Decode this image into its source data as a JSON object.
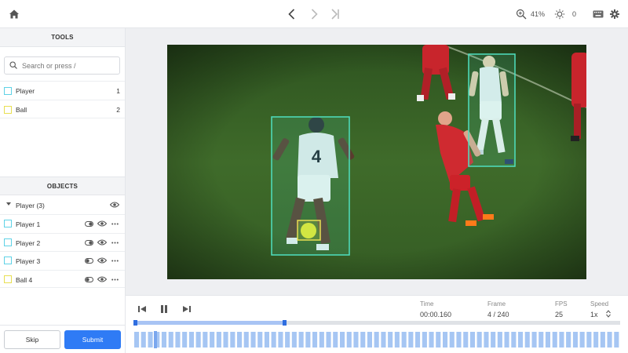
{
  "topbar": {
    "zoom_label": "41%",
    "brightness_value": "0",
    "icons": [
      "home-icon",
      "chevron-left-icon",
      "chevron-right-icon",
      "skip-to-end-icon",
      "zoom-icon",
      "brightness-icon",
      "keyboard-icon",
      "gear-icon"
    ]
  },
  "tools": {
    "header": "TOOLS",
    "search_placeholder": "Search or press /",
    "items": [
      {
        "label": "Player",
        "shortcut": "1",
        "color": "#5fd2e6"
      },
      {
        "label": "Ball",
        "shortcut": "2",
        "color": "#e8df52"
      }
    ]
  },
  "objects": {
    "header": "OBJECTS",
    "group_label": "Player (3)",
    "items": [
      {
        "label": "Player 1",
        "color": "#5fd2e6"
      },
      {
        "label": "Player 2",
        "color": "#5fd2e6"
      },
      {
        "label": "Player 3",
        "color": "#5fd2e6"
      },
      {
        "label": "Ball 4",
        "color": "#e8df52"
      }
    ]
  },
  "actions": {
    "skip_label": "Skip",
    "submit_label": "Submit"
  },
  "playback": {
    "time_label": "Time",
    "time_value": "00:00.160",
    "frame_label": "Frame",
    "frame_value": "4 / 240",
    "fps_label": "FPS",
    "fps_value": "25",
    "speed_label": "Speed",
    "speed_value": "1x",
    "progress_fraction": 0.31,
    "current_frame": 4,
    "total_frames": 240
  },
  "colors": {
    "accent": "#2f7bf5",
    "player_box": "#4fe0c0",
    "ball_box": "#e8df52",
    "pitch": "#3f6b2a"
  }
}
